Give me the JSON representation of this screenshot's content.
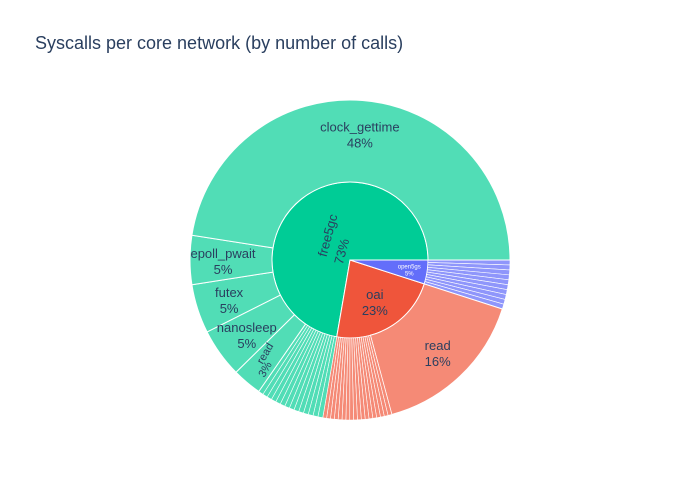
{
  "chart_data": {
    "type": "sunburst",
    "title": "Syscalls per core network (by number of calls)",
    "rings": [
      {
        "level": "core_network",
        "items": [
          {
            "label": "free5gc",
            "percent": 73,
            "color": "#00cc96"
          },
          {
            "label": "oai",
            "percent": 23,
            "color": "#ef553b"
          },
          {
            "label": "open5gs",
            "percent": 5,
            "color": "#636efa"
          }
        ]
      },
      {
        "level": "syscall",
        "items": [
          {
            "parent": "free5gc",
            "label": "clock_gettime",
            "percent": 48
          },
          {
            "parent": "free5gc",
            "label": "epoll_pwait",
            "percent": 5
          },
          {
            "parent": "free5gc",
            "label": "futex",
            "percent": 5
          },
          {
            "parent": "free5gc",
            "label": "nanosleep",
            "percent": 5
          },
          {
            "parent": "free5gc",
            "label": "read",
            "percent": 3
          },
          {
            "parent": "oai",
            "label": "read",
            "percent": 16
          }
        ]
      }
    ],
    "colors": {
      "free5gc_outer": "#51ddb6",
      "oai_outer": "#f58a76",
      "open5gs_outer": "#8f96fb"
    }
  }
}
